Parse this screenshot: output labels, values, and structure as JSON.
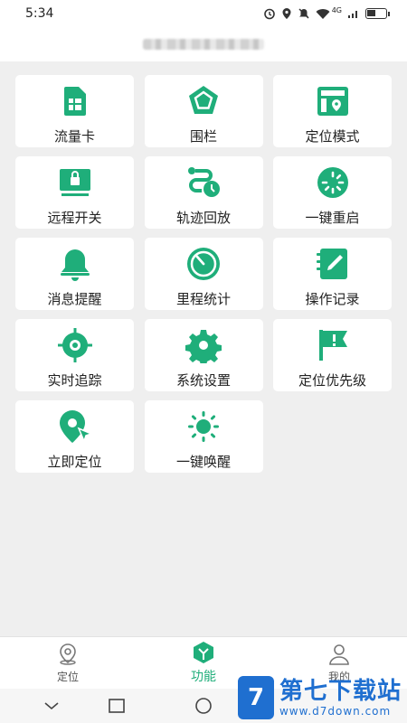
{
  "status_bar": {
    "time": "5:34",
    "network": "4G"
  },
  "colors": {
    "accent": "#1fae7a",
    "background": "#efefef",
    "tile": "#ffffff"
  },
  "grid": {
    "tiles": [
      {
        "label": "流量卡",
        "icon": "sim-card-icon"
      },
      {
        "label": "围栏",
        "icon": "pentagon-fence-icon"
      },
      {
        "label": "定位模式",
        "icon": "location-mode-icon"
      },
      {
        "label": "远程开关",
        "icon": "remote-switch-icon"
      },
      {
        "label": "轨迹回放",
        "icon": "track-playback-icon"
      },
      {
        "label": "一键重启",
        "icon": "restart-icon"
      },
      {
        "label": "消息提醒",
        "icon": "bell-icon"
      },
      {
        "label": "里程统计",
        "icon": "odometer-icon"
      },
      {
        "label": "操作记录",
        "icon": "notebook-pen-icon"
      },
      {
        "label": "实时追踪",
        "icon": "target-icon"
      },
      {
        "label": "系统设置",
        "icon": "gear-icon"
      },
      {
        "label": "定位优先级",
        "icon": "flag-icon"
      },
      {
        "label": "立即定位",
        "icon": "locate-now-icon"
      },
      {
        "label": "一键唤醒",
        "icon": "sun-wake-icon"
      }
    ]
  },
  "bottom_nav": {
    "items": [
      {
        "label": "定位",
        "icon": "location-pin-icon",
        "active": false
      },
      {
        "label": "功能",
        "icon": "cube-icon",
        "active": true
      },
      {
        "label": "我的",
        "icon": "person-icon",
        "active": false
      }
    ]
  },
  "watermark": {
    "title": "第七下载站",
    "url": "www.d7down.com",
    "logo_letter": "7"
  }
}
